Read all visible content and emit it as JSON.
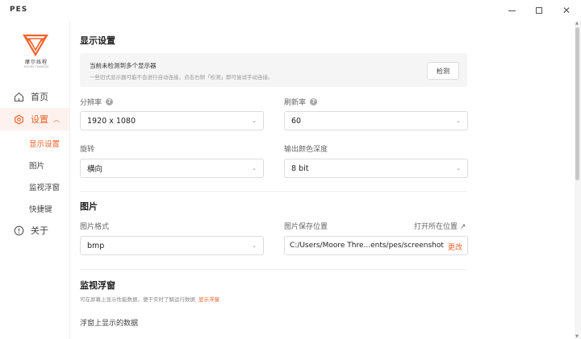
{
  "app": {
    "title": "PES"
  },
  "window": {
    "minimize": "—",
    "maximize": "□",
    "close": "✕"
  },
  "sidebar": {
    "logo_text": "摩尔线程",
    "logo_sub": "MOORE THREADS",
    "home": "首页",
    "settings": "设置",
    "about": "关于",
    "sub_items": [
      "显示设置",
      "图片",
      "监视浮窗",
      "快捷键"
    ]
  },
  "display": {
    "title": "显示设置",
    "banner_title": "当前未检测到多个显示器",
    "banner_desc": "一些旧式显示器可能不会进行自动连接，点击右侧「检测」即可尝试手动连接。",
    "detect_label": "检测",
    "resolution_label": "分辨率",
    "resolution_value": "1920 x 1080",
    "refresh_label": "刷新率",
    "refresh_value": "60",
    "rotation_label": "旋转",
    "rotation_value": "横向",
    "depth_label": "输出颜色深度",
    "depth_value": "8 bit"
  },
  "image": {
    "title": "图片",
    "format_label": "图片格式",
    "format_value": "bmp",
    "location_label": "图片保存位置",
    "open_location": "打开所在位置 ↗",
    "path_value": "C:/Users/Moore Thre...ents/pes/screenshot",
    "change_label": "更改"
  },
  "monitor": {
    "title": "监视浮窗",
    "desc": "可在屏幕上显示性能数据，便于实时了解运行数据",
    "link": "显示浮窗",
    "float_data_label": "浮窗上显示的数据"
  },
  "colors": {
    "accent": "#f0632a"
  }
}
